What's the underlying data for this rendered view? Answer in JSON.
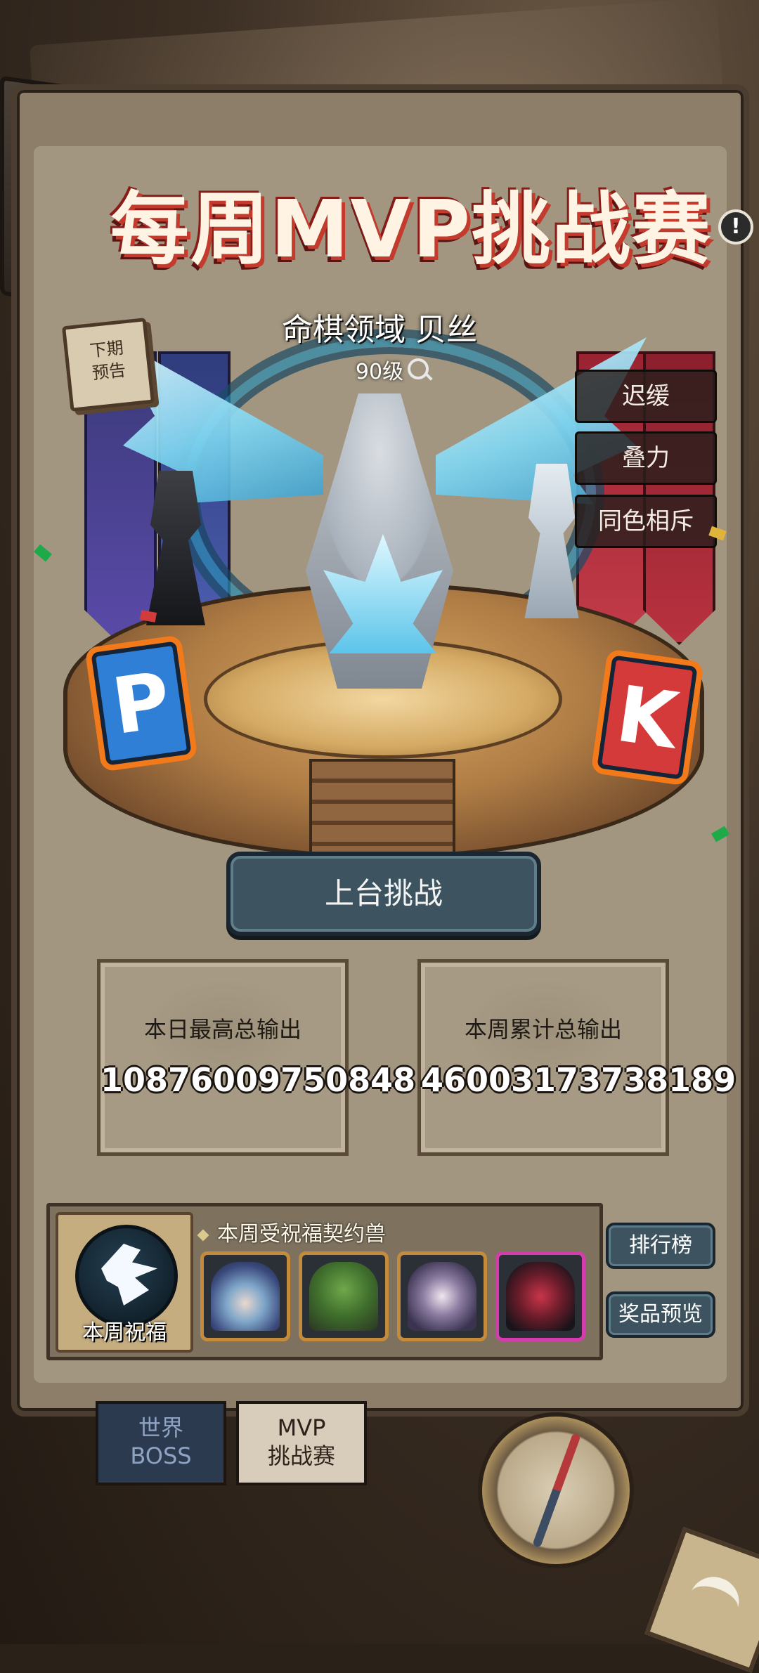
{
  "header": {
    "title": "每周MVP挑战赛"
  },
  "boss": {
    "name": "命棋领域 贝丝",
    "level": "90级"
  },
  "next_preview": {
    "line1": "下期",
    "line2": "预告"
  },
  "traits": [
    "迟缓",
    "叠力",
    "同色相斥"
  ],
  "signs": {
    "left": "P",
    "right": "K"
  },
  "actions": {
    "challenge": "上台挑战",
    "leaderboard": "排行榜",
    "prize_preview": "奖品预览"
  },
  "stats": {
    "daily": {
      "label": "本日最高总输出",
      "value": "10876009750848"
    },
    "weekly": {
      "label": "本周累计总输出",
      "value": "46003173738189"
    }
  },
  "blessing": {
    "label": "本周祝福",
    "beasts_title": "本周受祝福契约兽",
    "beasts": [
      {
        "icon": "hooded-mage-beast-icon"
      },
      {
        "icon": "moss-turtle-beast-icon"
      },
      {
        "icon": "wolf-beast-icon"
      },
      {
        "icon": "dragon-beast-icon"
      }
    ]
  },
  "tabs": {
    "world_boss": {
      "line1": "世界",
      "line2": "BOSS"
    },
    "mvp": {
      "line1": "MVP",
      "line2": "挑战赛"
    }
  },
  "colors": {
    "button": "#3d5460",
    "title_outline": "#c43a2c",
    "epic_border": "#d53cae",
    "rare_border": "#c58b3c"
  }
}
